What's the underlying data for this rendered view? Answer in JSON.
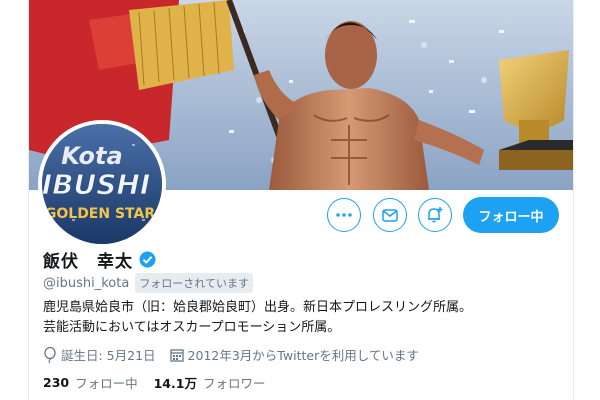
{
  "banner": {
    "description_icon": "wrestler-banner-image"
  },
  "avatar": {
    "text_top": "Kota",
    "text_mid": "IBUSHI",
    "text_bottom": "GOLDEN STAR"
  },
  "actions": {
    "more_icon": "more-dots-icon",
    "message_icon": "envelope-icon",
    "notify_icon": "bell-plus-icon",
    "follow_label": "フォロー中"
  },
  "profile": {
    "display_name": "飯伏　幸太",
    "handle": "@ibushi_kota",
    "follows_you": "フォローされています",
    "bio_line1": "鹿児島県姶良市（旧：姶良郡姶良町）出身。新日本プロレスリング所属。",
    "bio_line2": "芸能活動においてはオスカープロモーション所属。",
    "birthday": "誕生日: 5月21日",
    "joined": "2012年3月からTwitterを利用しています"
  },
  "stats": {
    "following_count": "230",
    "following_label": "フォロー中",
    "followers_count": "14.1万",
    "followers_label": "フォロワー"
  },
  "colors": {
    "accent": "#1da1f2",
    "text": "#14171a",
    "muted": "#657786"
  }
}
